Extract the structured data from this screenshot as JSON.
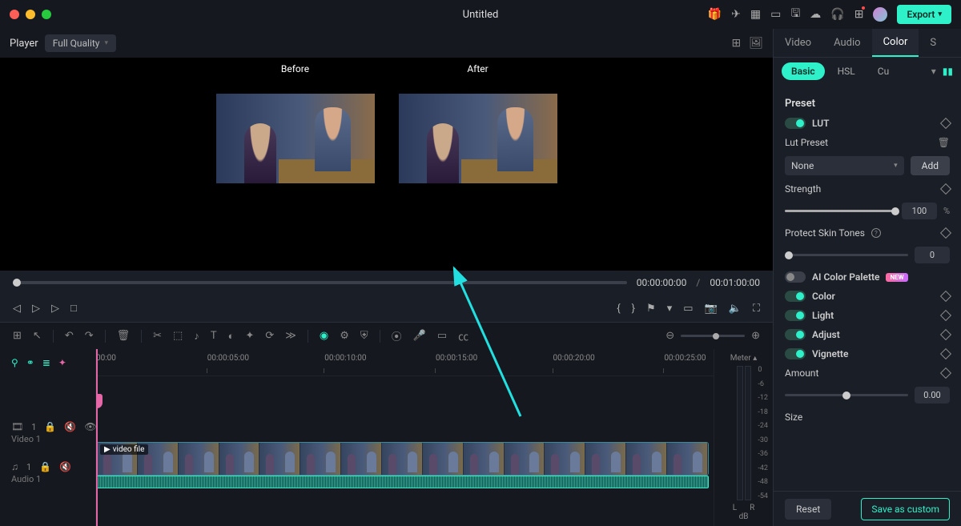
{
  "titlebar": {
    "title": "Untitled",
    "export": "Export"
  },
  "player_bar": {
    "label": "Player",
    "quality": "Full Quality"
  },
  "preview": {
    "before": "Before",
    "after": "After"
  },
  "scrubber": {
    "current": "00:00:00:00",
    "sep": "/",
    "total": "00:01:00:00"
  },
  "timeline": {
    "ticks": [
      {
        "label": "00:00",
        "pct": 0
      },
      {
        "label": "00:00:05:00",
        "pct": 18
      },
      {
        "label": "00:00:10:00",
        "pct": 37
      },
      {
        "label": "00:00:15:00",
        "pct": 55
      },
      {
        "label": "00:00:20:00",
        "pct": 74
      },
      {
        "label": "00:00:25:00",
        "pct": 92
      }
    ],
    "clip_label": "video file",
    "video_track": "Video 1",
    "audio_track": "Audio 1",
    "meter": {
      "label": "Meter",
      "nums": [
        "0",
        "-6",
        "-12",
        "-18",
        "-24",
        "-30",
        "-36",
        "-42",
        "-48",
        "-54"
      ],
      "left": "L",
      "right": "R",
      "db": "dB"
    }
  },
  "panel": {
    "tabs": {
      "video": "Video",
      "audio": "Audio",
      "color": "Color",
      "speed": "S"
    },
    "subtabs": {
      "basic": "Basic",
      "hsl": "HSL",
      "curves": "Cu"
    },
    "preset_title": "Preset",
    "lut": {
      "label": "LUT"
    },
    "lut_preset": {
      "label": "Lut Preset",
      "select": "None",
      "add": "Add"
    },
    "strength": {
      "label": "Strength",
      "value": "100",
      "unit": "%"
    },
    "skin": {
      "label": "Protect Skin Tones",
      "value": "0"
    },
    "ai_palette": {
      "label": "AI Color Palette",
      "badge": "NEW"
    },
    "color": {
      "label": "Color"
    },
    "light": {
      "label": "Light"
    },
    "adjust": {
      "label": "Adjust"
    },
    "vignette": {
      "label": "Vignette"
    },
    "amount": {
      "label": "Amount",
      "value": "0.00"
    },
    "size": {
      "label": "Size"
    },
    "reset": "Reset",
    "save": "Save as custom"
  }
}
